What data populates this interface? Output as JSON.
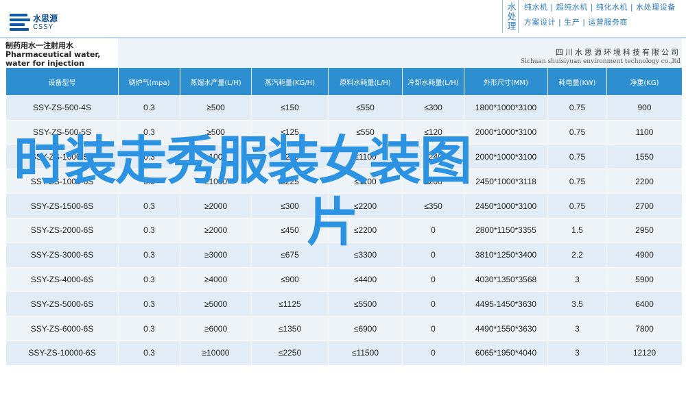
{
  "header": {
    "logo_cn": "水思源",
    "logo_en": "CSSY",
    "tag_vertical": "水处理",
    "tag_line1": "纯水机 | 超纯水机 | 纯化水机 | 水处理设备",
    "tag_line2": "方案设计 | 生产 | 运营服务商"
  },
  "title": {
    "cn": "制药用水一注射用水",
    "en": "Pharmaceutical water, water for injection",
    "company_cn": "四川水思源环境科技有限公司",
    "company_en": "Sichuan shuisiyuan environment technology co.,ltd"
  },
  "table": {
    "headers": [
      "设备型号",
      "锅炉气(mpa)",
      "蒸馏水产量(L/H)",
      "蒸汽耗量(KG/H)",
      "原料水耗量(L/H)",
      "冷却水耗量(L/H)",
      "外形尺寸(MM)",
      "耗电量(KW)",
      "净重(KG)"
    ],
    "rows": [
      [
        "SSY-ZS-500-4S",
        "0.3",
        "≥500",
        "≤150",
        "≤550",
        "≤300",
        "1800*1000*3100",
        "0.75",
        "900"
      ],
      [
        "SSY-ZS-500-5S",
        "0.3",
        "≥500",
        "≤125",
        "≤550",
        "≤120",
        "2000*1000*3100",
        "0.75",
        "1100"
      ],
      [
        "SSY-ZS-1000-5S",
        "0.3",
        "≥1000",
        "≤250",
        "≤1100",
        "≤240",
        "2000*1000*3100",
        "0.75",
        "1550"
      ],
      [
        "SSY-ZS-1000-6S",
        "0.3",
        "≥1000",
        "≤225",
        "≤1100",
        "≤200",
        "2450*1000*3118",
        "0.75",
        "2200"
      ],
      [
        "SSY-ZS-1500-6S",
        "0.3",
        "≥2000",
        "≤300",
        "≤2200",
        "≤350",
        "2450*1000*3100",
        "0.75",
        "2700"
      ],
      [
        "SSY-ZS-2000-6S",
        "0.3",
        "≥2000",
        "≤450",
        "≤2200",
        "0",
        "2800*1150*3355",
        "1.5",
        "2950"
      ],
      [
        "SSY-ZS-3000-6S",
        "0.3",
        "≥3000",
        "≤675",
        "≤3300",
        "0",
        "3810*1250*3400",
        "2.2",
        "4900"
      ],
      [
        "SSY-ZS-4000-6S",
        "0.3",
        "≥4000",
        "≤900",
        "≤4400",
        "0",
        "4030*1350*3568",
        "3",
        "5900"
      ],
      [
        "SSY-ZS-5000-6S",
        "0.3",
        "≥5000",
        "≤1125",
        "≤5500",
        "0",
        "4495-1450*3630",
        "3.5",
        "6400"
      ],
      [
        "SSY-ZS-6000-6S",
        "0.3",
        "≥6000",
        "≤1350",
        "≤6900",
        "0",
        "4490*1550*3630",
        "3",
        "7800"
      ],
      [
        "SSY-ZS-10000-6S",
        "0.3",
        "≥10000",
        "≤2250",
        "≤11500",
        "0",
        "6065*1950*4040",
        "3",
        "12120"
      ]
    ]
  },
  "overlay": {
    "line1": "时装走秀服装女装图",
    "line2": "片"
  },
  "colors": {
    "header_blue": "#2e8fd0",
    "row_odd": "#e2ecf6",
    "row_even": "#eef3f8",
    "overlay_text": "#2b93e2"
  }
}
